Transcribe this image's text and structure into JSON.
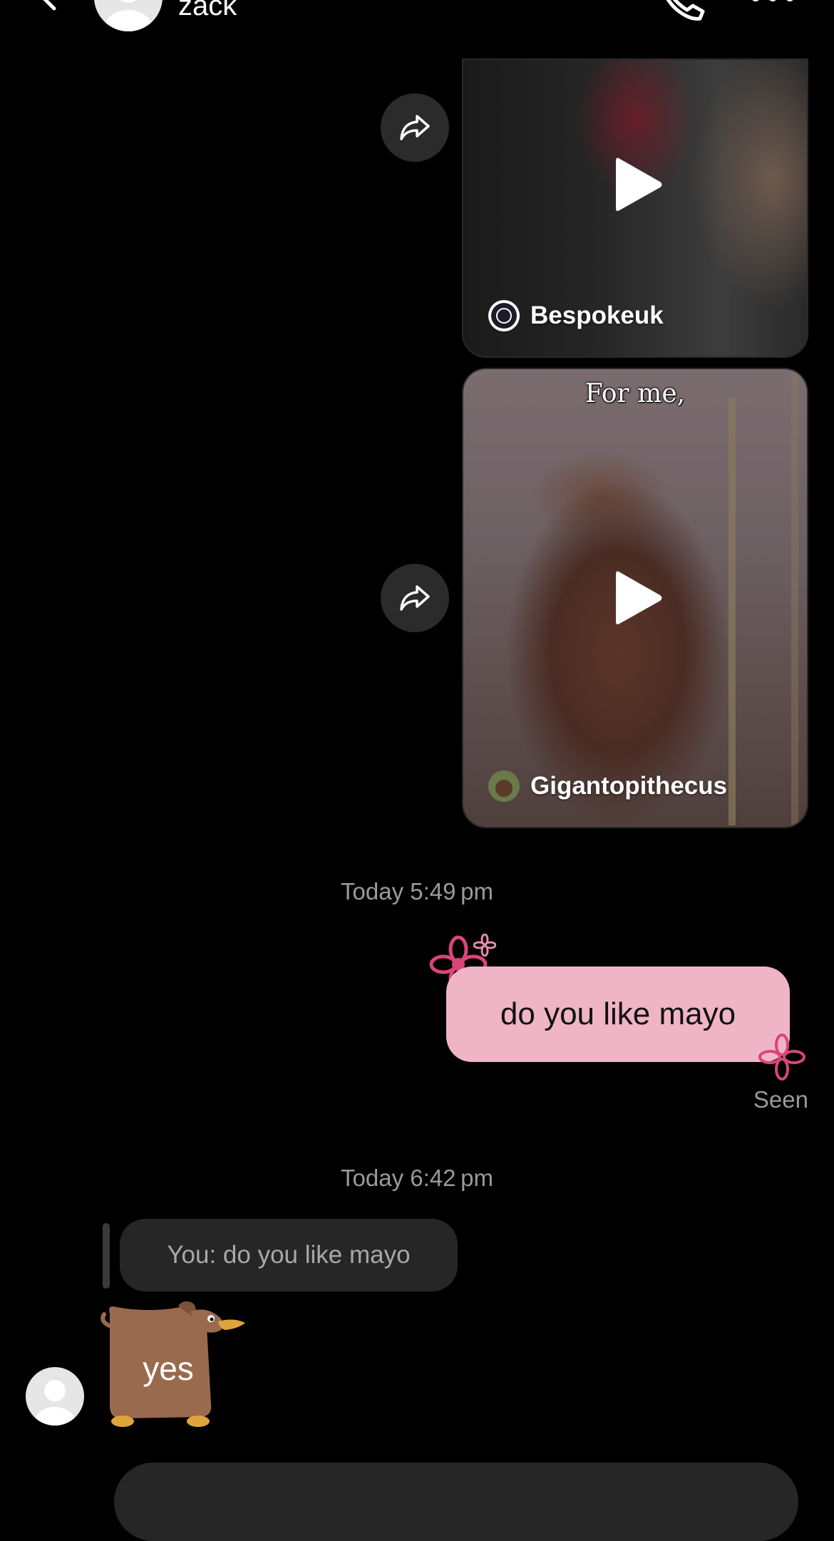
{
  "header": {
    "contact_name": "zack",
    "icons": [
      "back-icon",
      "avatar",
      "phone-icon",
      "more-icon"
    ]
  },
  "messages": {
    "shared_video_1": {
      "creator": "Bespokeuk"
    },
    "shared_video_2": {
      "caption": "For me,",
      "creator": "Gigantopithecus"
    },
    "timestamp_1": "Today 5:49 pm",
    "sent_message": "do you like mayo",
    "seen_label": "Seen",
    "timestamp_2": "Today 6:42 pm",
    "reply_quote": "You: do you like mayo",
    "sticker_text": "yes"
  },
  "colors": {
    "background": "#000000",
    "sent_bubble": "#f0b4c7",
    "reply_bubble": "#262626",
    "flower": "#d9457a",
    "muted_text": "#9a9a9a"
  }
}
